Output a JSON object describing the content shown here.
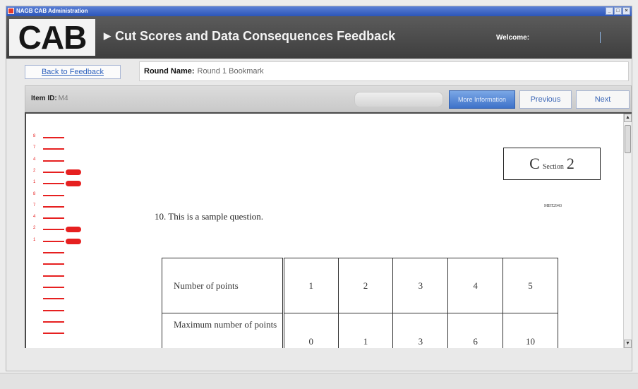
{
  "window": {
    "title": "NAGB CAB Administration",
    "controls": [
      "_",
      "□",
      "×"
    ]
  },
  "header": {
    "logo": "CAB",
    "title": "Cut Scores and Data Consequences Feedback",
    "welcome_label": "Welcome:"
  },
  "nav": {
    "back_label": "Back to Feedback",
    "round_label": "Round Name:",
    "round_value": "Round 1 Bookmark"
  },
  "toolbar": {
    "item_id_label": "Item ID:",
    "item_id_value": "M4",
    "more_info_label": "More Information",
    "previous_label": "Previous",
    "next_label": "Next"
  },
  "viewer": {
    "section_letter": "C",
    "section_word": "Section",
    "section_number": "2",
    "page_code": "MBT2943",
    "question_text": "10. This is a sample question.",
    "table": {
      "row1_label": "Number of points",
      "row1_values": [
        "1",
        "2",
        "3",
        "4",
        "5"
      ],
      "row2_label": "Maximum number of points",
      "row2_values": [
        "0",
        "1",
        "3",
        "6",
        "10"
      ]
    },
    "marks": [
      {
        "num": "8",
        "pill": false
      },
      {
        "num": "7",
        "pill": false
      },
      {
        "num": "4",
        "pill": false
      },
      {
        "num": "2",
        "pill": true
      },
      {
        "num": "1",
        "pill": true
      },
      {
        "num": "8",
        "pill": false
      },
      {
        "num": "7",
        "pill": false
      },
      {
        "num": "4",
        "pill": false
      },
      {
        "num": "2",
        "pill": true
      },
      {
        "num": "1",
        "pill": true
      },
      {
        "num": "",
        "pill": false
      },
      {
        "num": "",
        "pill": false
      },
      {
        "num": "",
        "pill": false
      },
      {
        "num": "",
        "pill": false
      },
      {
        "num": "",
        "pill": false
      },
      {
        "num": "",
        "pill": false
      },
      {
        "num": "",
        "pill": false
      },
      {
        "num": "",
        "pill": false
      }
    ]
  },
  "colors": {
    "accent_red": "#e62020",
    "header_bg": "#4a4a4a",
    "link_blue": "#2d61bd"
  }
}
